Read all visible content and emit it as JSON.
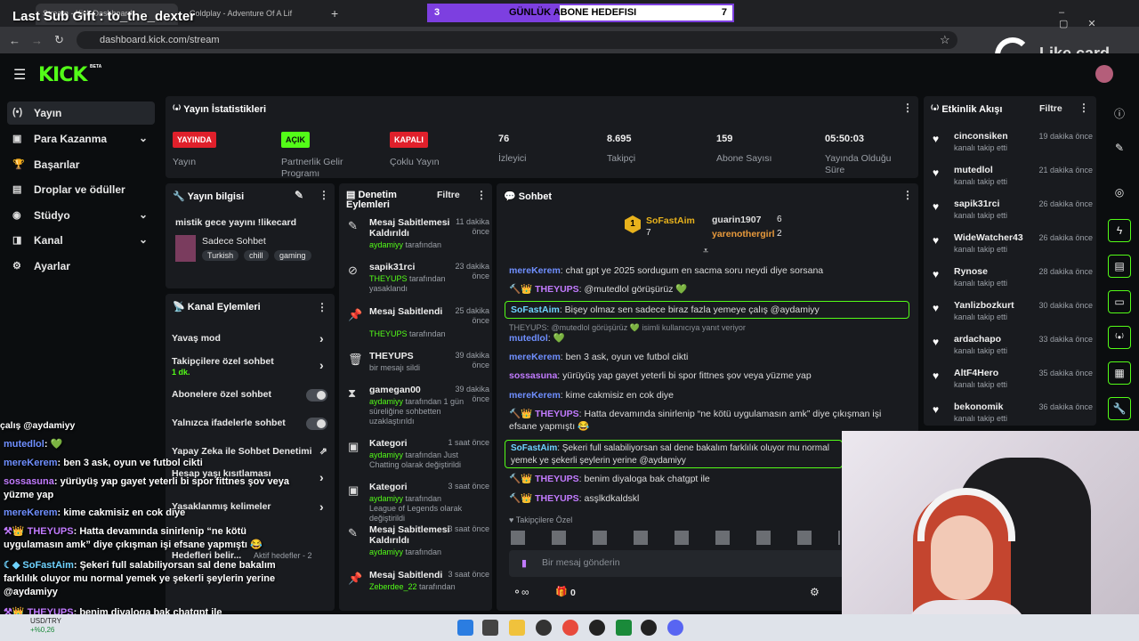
{
  "browser": {
    "tabs": [
      "Stream - Kick Dashboard",
      "Coldplay - Adventure Of A Lif"
    ],
    "url": "dashboard.kick.com/stream"
  },
  "overlay": {
    "last_sub_gift": "Last Sub Gift : to_the_dexter",
    "goal_start": "3",
    "goal_label": "GÜNLÜK ABONE HEDEFISI",
    "goal_end": "7",
    "likecard": "Like card"
  },
  "logo": {
    "text": "KICK",
    "beta": "BETA"
  },
  "sidebar": {
    "items": [
      {
        "label": "Yayın",
        "icon": "(•)"
      },
      {
        "label": "Para Kazanma",
        "icon": "▣"
      },
      {
        "label": "Başarılar",
        "icon": "🏆"
      },
      {
        "label": "Droplar ve ödüller",
        "icon": "▤"
      },
      {
        "label": "Stüdyo",
        "icon": "◉"
      },
      {
        "label": "Kanal",
        "icon": "◨"
      },
      {
        "label": "Ayarlar",
        "icon": "⚙"
      }
    ]
  },
  "stats": {
    "title": "Yayın İstatistikleri",
    "cards": [
      {
        "badge": "YAYINDA",
        "label": "Yayın"
      },
      {
        "badge": "AÇIK",
        "label": "Partnerlik Gelir Programı"
      },
      {
        "badge": "KAPALI",
        "label": "Çoklu Yayın"
      },
      {
        "value": "76",
        "label": "İzleyici"
      },
      {
        "value": "8.695",
        "label": "Takipçi"
      },
      {
        "value": "159",
        "label": "Abone Sayısı"
      },
      {
        "value": "05:50:03",
        "label": "Yayında Olduğu Süre"
      }
    ]
  },
  "stream_info": {
    "title": "Yayın bilgisi",
    "stream_title": "mistik gece yayını !likecard",
    "category": "Sadece Sohbet",
    "tags": [
      "Turkish",
      "chill",
      "gaming"
    ]
  },
  "channel_actions": {
    "title": "Kanal Eylemleri",
    "items": [
      {
        "label": "Yavaş mod"
      },
      {
        "label": "Takipçilere özel sohbet",
        "sub": "1 dk."
      },
      {
        "label": "Abonelere özel sohbet"
      },
      {
        "label": "Yalnızca ifadelerle sohbet"
      },
      {
        "label": "Yapay Zeka ile Sohbet Denetimi"
      },
      {
        "label": "Hesap yaşı kısıtlaması"
      },
      {
        "label": "Yasaklanmış kelimeler"
      },
      {
        "label": "Hedefleri belir...",
        "sub": "Aktif hedefler - 2"
      }
    ]
  },
  "moderation": {
    "title": "Denetim Eylemleri",
    "filter": "Filtre",
    "items": [
      {
        "title": "Mesaj Sabitlemesi Kaldırıldı",
        "time": "11 dakika önce",
        "user": "aydamiyy",
        "rest": " tarafından"
      },
      {
        "title": "sapik31rci",
        "time": "23 dakika önce",
        "user": "THEYUPS",
        "rest": " tarafından yasaklandı"
      },
      {
        "title": "Mesaj Sabitlendi",
        "time": "25 dakika önce",
        "user": "THEYUPS",
        "rest": " tarafından"
      },
      {
        "title": "THEYUPS",
        "time": "39 dakika önce",
        "user": "",
        "rest": "bir mesajı sildi"
      },
      {
        "title": "gamegan00",
        "time": "39 dakika önce",
        "user": "aydamiyy",
        "rest": " tarafından 1 gün süreliğine sohbetten uzaklaştırıldı"
      },
      {
        "title": "Kategori",
        "time": "1 saat önce",
        "user": "aydamiyy",
        "rest": " tarafından Just Chatting olarak değiştirildi"
      },
      {
        "title": "Kategori",
        "time": "3 saat önce",
        "user": "aydamiyy",
        "rest": " tarafından League of Legends olarak değiştirildi"
      },
      {
        "title": "Mesaj Sabitlemesi Kaldırıldı",
        "time": "3 saat önce",
        "user": "aydamiyy",
        "rest": " tarafından"
      },
      {
        "title": "Mesaj Sabitlendi",
        "time": "3 saat önce",
        "user": "Zeberdee_22",
        "rest": " tarafından"
      }
    ]
  },
  "chat": {
    "title": "Sohbet",
    "top_gifters": [
      {
        "name": "SoFastAim",
        "count": "7"
      },
      {
        "name": "guarin1907",
        "count": "6"
      },
      {
        "name": "yarenothergirl",
        "count": "2"
      }
    ],
    "messages": [
      {
        "user": "mereKerem",
        "text": ": chat gpt ye 2025 sordugum en sacma soru neydi diye sorsana"
      },
      {
        "user": "THEYUPS",
        "text": ": @mutedlol görüşürüz 💚"
      },
      {
        "user": "SoFastAim",
        "text": ": Bişey olmaz sen sadece biraz fazla yemeye çalış @aydamiyy"
      },
      {
        "user": "THEYUPS",
        "text": ": @mutedlol görüşürüz 💚 isimli kullanıcıya yanıt veriyor"
      },
      {
        "user": "mutedlol",
        "text": ": 💚"
      },
      {
        "user": "mereKerem",
        "text": ": ben 3 ask, oyun ve futbol cikti"
      },
      {
        "user": "sossasuna",
        "text": ": yürüyüş yap gayet yeterli bi spor fittnes şov veya yüzme yap"
      },
      {
        "user": "mereKerem",
        "text": ": kime cakmisiz en cok diye"
      },
      {
        "user": "THEYUPS",
        "text": ": Hatta devamında sinirlenip “ne kötü uygulamasın amk” diye çıkışman işi efsane yapmıştı 😂"
      },
      {
        "user": "SoFastAim",
        "text": ": Şekeri full salabiliyorsan sal dene bakalım farklılık oluyor mu normal yemek ye şekerli şeylerin yerine @aydamiyy"
      },
      {
        "user": "THEYUPS",
        "text": ": benim diyaloga bak chatgpt ile"
      },
      {
        "user": "THEYUPS",
        "text": ": asşlkdkaldskl"
      }
    ],
    "followers_only": "Takipçilere Özel",
    "input_placeholder": "Bir mesaj gönderin",
    "points": "0"
  },
  "activity": {
    "title": "Etkinlik Akışı",
    "filter": "Filtre",
    "items": [
      {
        "name": "cinconsiken",
        "time": "19 dakika önce",
        "sub": "kanalı takip etti"
      },
      {
        "name": "mutedlol",
        "time": "21 dakika önce",
        "sub": "kanalı takip etti"
      },
      {
        "name": "sapik31rci",
        "time": "26 dakika önce",
        "sub": "kanalı takip etti"
      },
      {
        "name": "WideWatcher43",
        "time": "26 dakika önce",
        "sub": "kanalı takip etti"
      },
      {
        "name": "Rynose",
        "time": "28 dakika önce",
        "sub": "kanalı takip etti"
      },
      {
        "name": "Yanlizbozkurt",
        "time": "30 dakika önce",
        "sub": "kanalı takip etti"
      },
      {
        "name": "ardachapo",
        "time": "33 dakika önce",
        "sub": "kanalı takip etti"
      },
      {
        "name": "AltF4Hero",
        "time": "35 dakika önce",
        "sub": "kanalı takip etti"
      },
      {
        "name": "bekonomik",
        "time": "36 dakika önce",
        "sub": "kanalı takip etti"
      }
    ]
  },
  "overlay_chat": [
    {
      "user": "",
      "text": "çalış @aydamiyy"
    },
    {
      "user": "mutedlol",
      "text": ": 💚"
    },
    {
      "user": "mereKerem",
      "text": ": ben 3 ask, oyun ve futbol cikti"
    },
    {
      "user": "sossasuna",
      "text": ": yürüyüş yap gayet yeterli bi spor fittnes şov veya yüzme yap"
    },
    {
      "user": "mereKerem",
      "text": ": kime cakmisiz en cok diye"
    },
    {
      "user": "THEYUPS",
      "text": ": Hatta devamında sinirlenip “ne kötü uygulamasın amk” diye çıkışman işi efsane yapmıştı 😂"
    },
    {
      "user": "SoFastAim",
      "text": ": Şekeri full salabiliyorsan sal dene bakalım farklılık oluyor mu normal yemek ye şekerli şeylerin yerine @aydamiyy"
    },
    {
      "user": "THEYUPS",
      "text": ": benim diyaloga bak chatgpt ile"
    }
  ],
  "ticker": {
    "pair": "USD/TRY",
    "change": "+%0,26"
  },
  "colors": {
    "kick_green": "#53fc18",
    "live_red": "#e0202b",
    "panel": "#191b1f"
  }
}
